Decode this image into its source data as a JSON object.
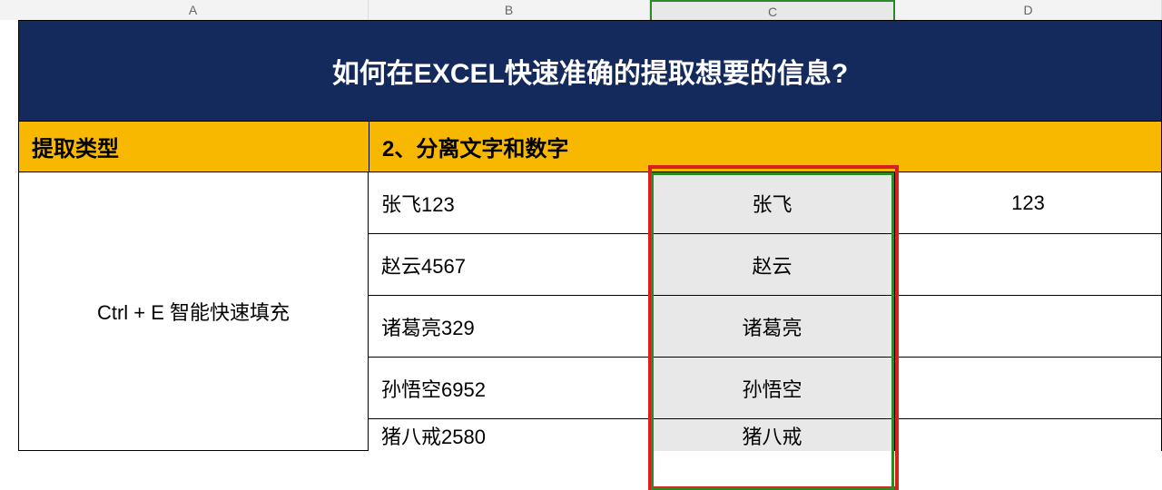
{
  "columns": {
    "a": "A",
    "b": "B",
    "c": "C",
    "d": "D"
  },
  "title": "如何在EXCEL快速准确的提取想要的信息?",
  "header": {
    "col1": "提取类型",
    "col2": "2、分离文字和数字"
  },
  "merged_label": "Ctrl + E 智能快速填充",
  "rows": [
    {
      "b": "张飞123",
      "c": "张飞",
      "d": "123"
    },
    {
      "b": "赵云4567",
      "c": "赵云",
      "d": ""
    },
    {
      "b": "诸葛亮329",
      "c": "诸葛亮",
      "d": ""
    },
    {
      "b": "孙悟空6952",
      "c": "孙悟空",
      "d": ""
    },
    {
      "b": "猪八戒2580",
      "c": "猪八戒",
      "d": ""
    }
  ]
}
